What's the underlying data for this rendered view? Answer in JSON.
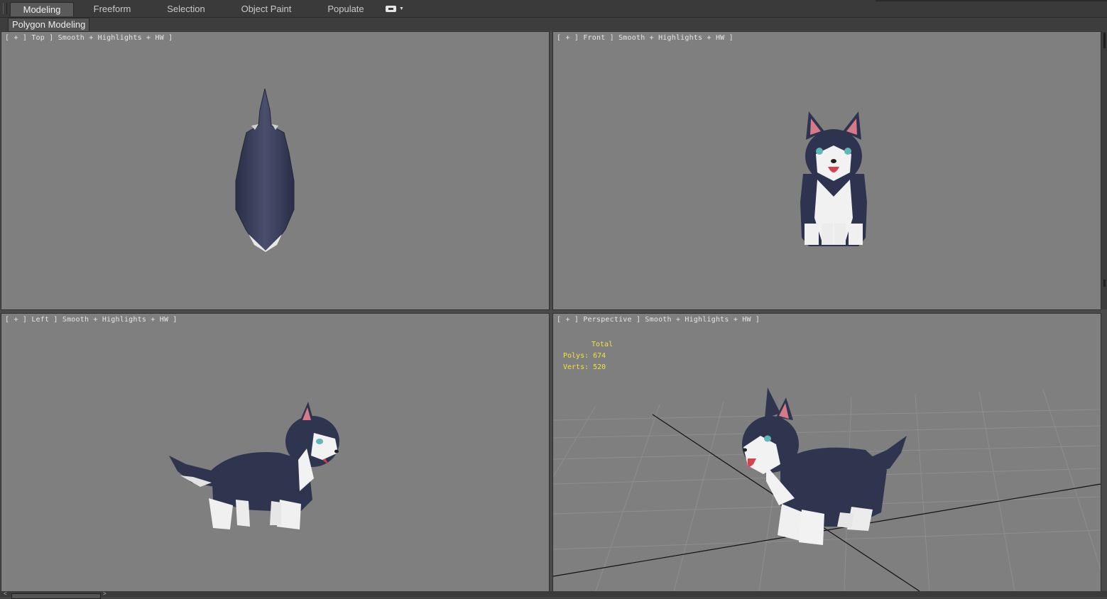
{
  "ribbon": {
    "tabs": [
      {
        "label": "Modeling",
        "active": true
      },
      {
        "label": "Freeform",
        "active": false
      },
      {
        "label": "Selection",
        "active": false
      },
      {
        "label": "Object Paint",
        "active": false
      },
      {
        "label": "Populate",
        "active": false
      }
    ],
    "options_icon": "ribbon-options-icon",
    "panel_label": "Polygon Modeling"
  },
  "viewports": {
    "top": {
      "label": "[ + ] Top ] Smooth + Highlights + HW ]"
    },
    "front": {
      "label": "[ + ] Front ] Smooth + Highlights + HW ]"
    },
    "left": {
      "label": "[ + ] Left ] Smooth + Highlights + HW ]"
    },
    "perspective": {
      "label": "[ + ] Perspective ] Smooth + Highlights + HW ]",
      "stats": {
        "title": "Total",
        "polys": "Polys: 674",
        "verts": "Verts: 520"
      }
    }
  },
  "colors": {
    "viewport_bg": "#7f7f7f",
    "fur_dark": "#2f3450",
    "fur_white": "#f2f2f2",
    "stats_text": "#f2e040"
  }
}
